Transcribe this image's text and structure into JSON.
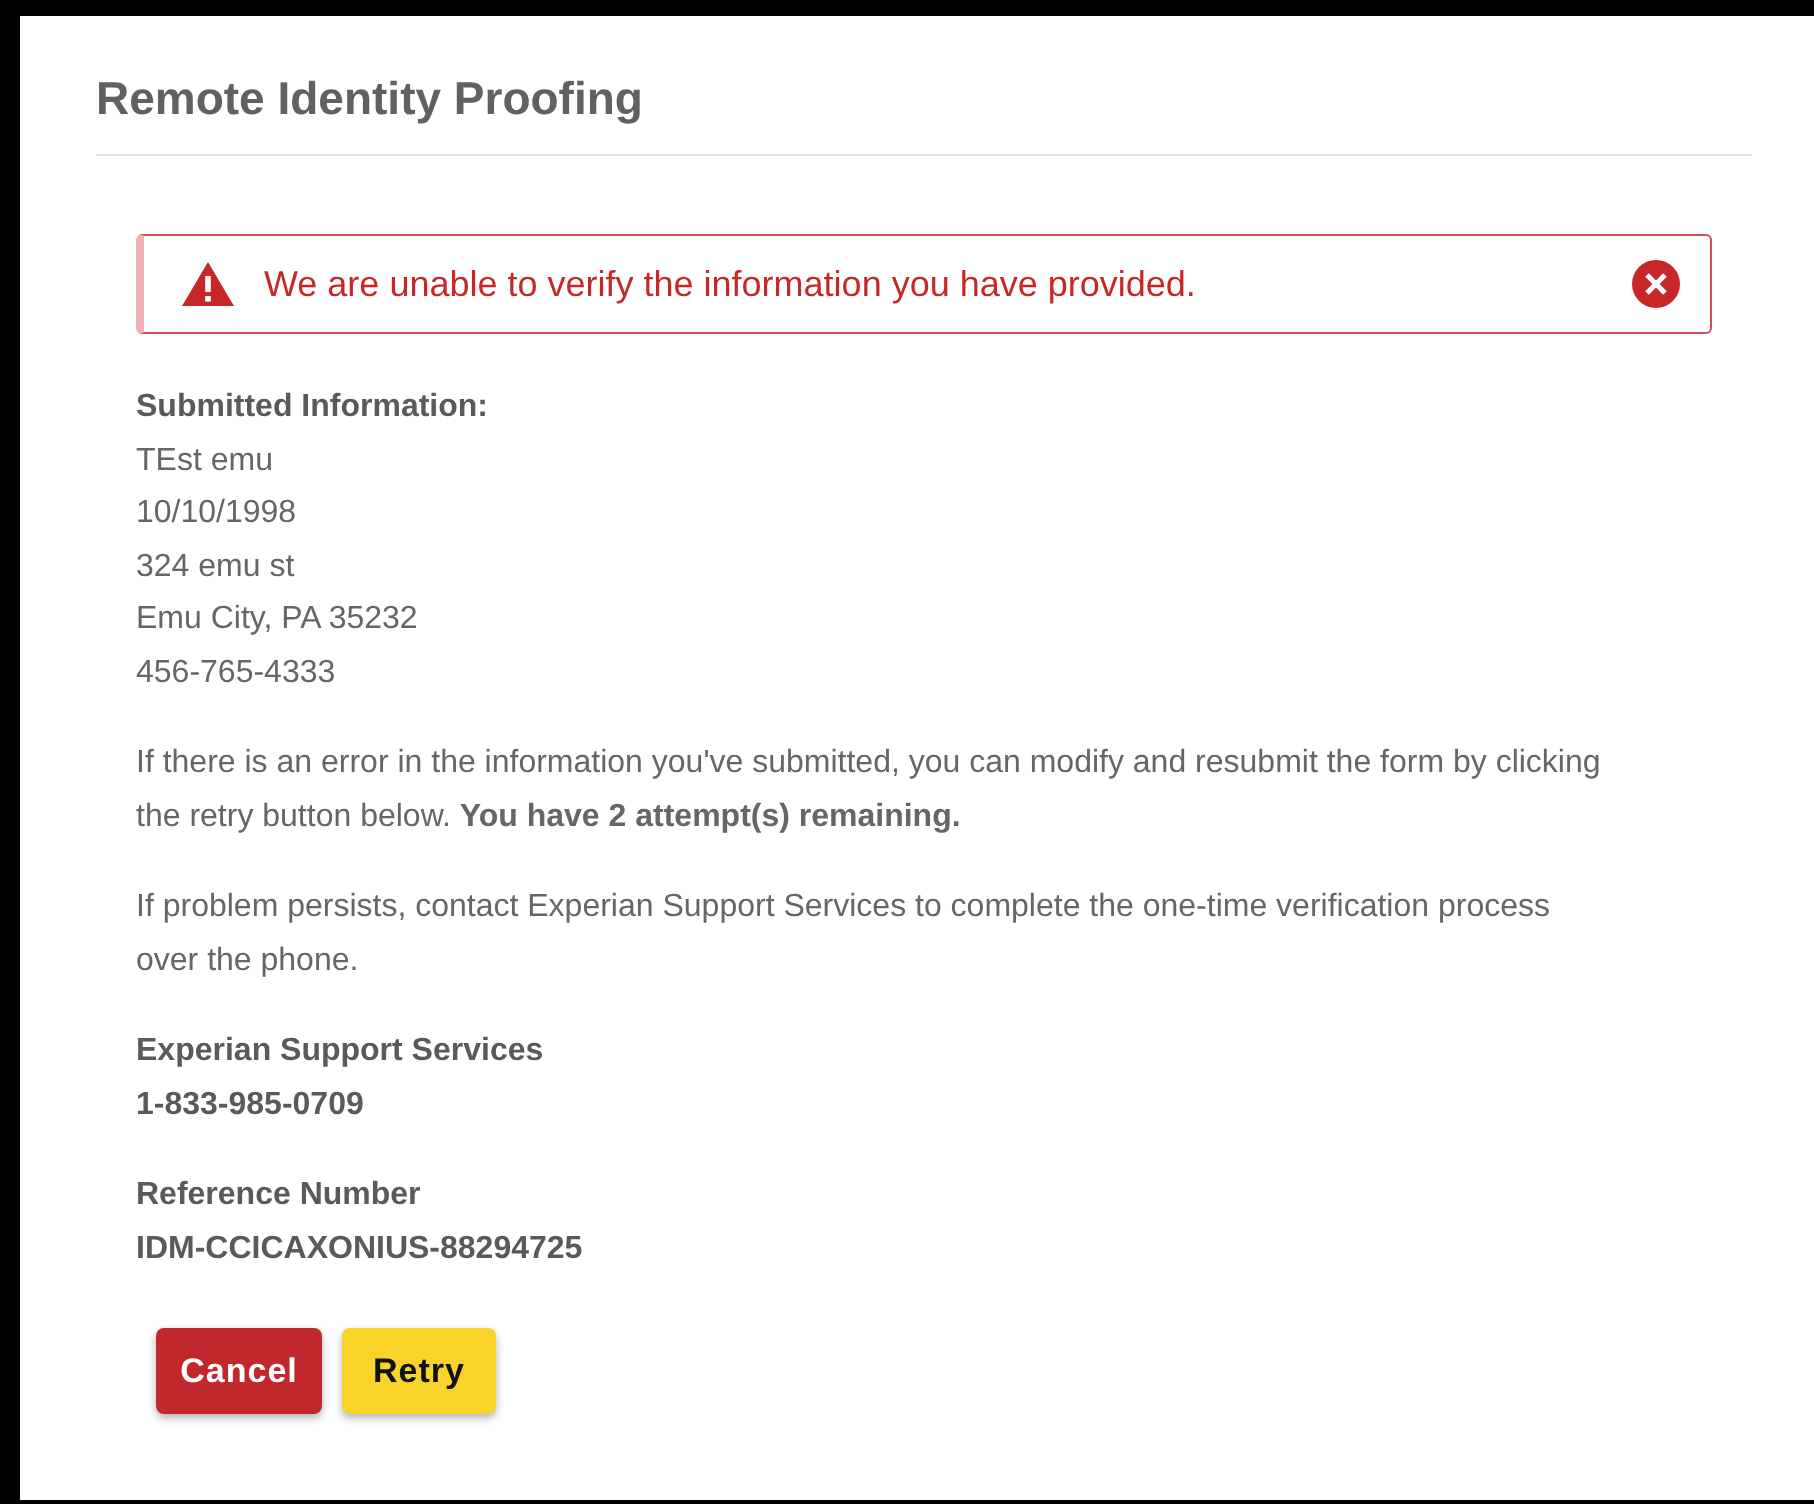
{
  "page": {
    "title": "Remote Identity Proofing"
  },
  "alert": {
    "message": "We are unable to verify the information you have provided."
  },
  "submitted": {
    "label": "Submitted Information:",
    "lines": [
      "TEst emu",
      "10/10/1998",
      "324 emu st",
      "Emu City, PA 35232",
      "456-765-4333"
    ]
  },
  "paragraphs": [
    "If there is an error in the information you've submitted, you can modify and resubmit the form by clicking the retry button below. **You have 2 attempt(s) remaining.**",
    "If problem persists, contact Experian Support Services to complete the one-time verification process over the phone."
  ],
  "contacts": [
    {
      "label": "Experian Support Services",
      "value": "1-833-985-0709"
    },
    {
      "label": "Reference Number",
      "value": "IDM-CCICAXONIUS-88294725"
    }
  ],
  "buttons": [
    {
      "label": "Cancel",
      "kind": "danger"
    },
    {
      "label": "Retry",
      "kind": "warning"
    }
  ]
}
